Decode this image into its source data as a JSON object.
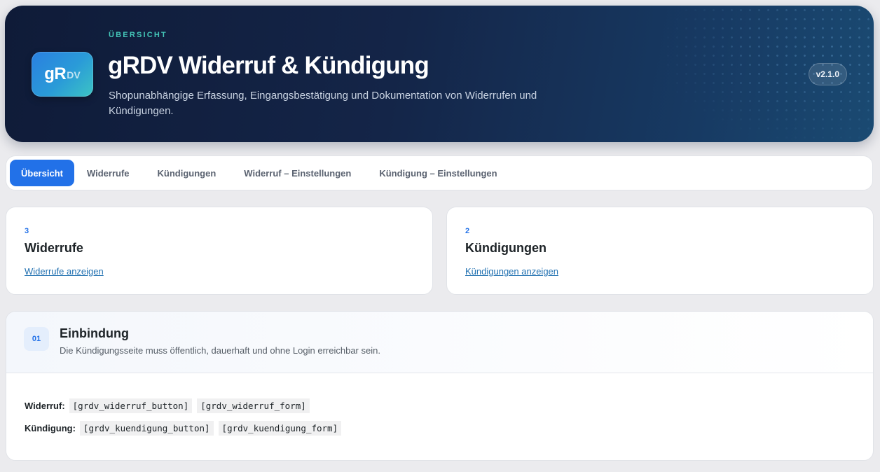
{
  "hero": {
    "eyebrow": "ÜBERSICHT",
    "logo_main": "gR",
    "logo_sub": "DV",
    "title": "gRDV Widerruf & Kündigung",
    "subtitle": "Shopunabhängige Erfassung, Eingangsbestätigung und Dokumentation von Widerrufen und Kündigungen.",
    "version": "v2.1.0"
  },
  "tabs": [
    {
      "label": "Übersicht",
      "active": true
    },
    {
      "label": "Widerrufe",
      "active": false
    },
    {
      "label": "Kündigungen",
      "active": false
    },
    {
      "label": "Widerruf – Einstellungen",
      "active": false
    },
    {
      "label": "Kündigung – Einstellungen",
      "active": false
    }
  ],
  "stats": [
    {
      "count": "3",
      "label": "Widerrufe",
      "link": "Widerrufe anzeigen"
    },
    {
      "count": "2",
      "label": "Kündigungen",
      "link": "Kündigungen anzeigen"
    }
  ],
  "section": {
    "step": "01",
    "title": "Einbindung",
    "description": "Die Kündigungsseite muss öffentlich, dauerhaft und ohne Login erreichbar sein.",
    "rows": [
      {
        "label": "Widerruf:",
        "codes": [
          "[grdv_widerruf_button]",
          "[grdv_widerruf_form]"
        ]
      },
      {
        "label": "Kündigung:",
        "codes": [
          "[grdv_kuendigung_button]",
          "[grdv_kuendigung_form]"
        ]
      }
    ]
  },
  "colors": {
    "accent": "#2271e8",
    "hero_bg": "#0f1b38",
    "eyebrow": "#44c6b8",
    "link": "#2271b1"
  }
}
